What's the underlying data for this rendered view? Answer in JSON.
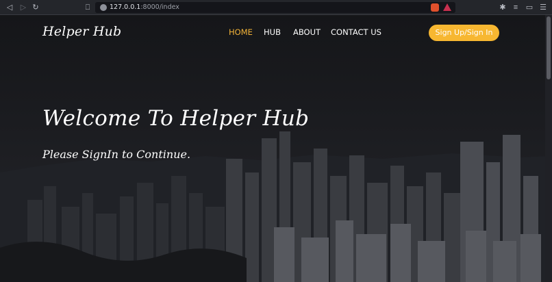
{
  "browser": {
    "url_host": "127.0.0.1",
    "url_rest": ":8000/index",
    "icons": [
      "back-icon",
      "forward-icon",
      "reload-icon",
      "bookmark-icon",
      "lock-icon",
      "brave-shields-icon",
      "brave-rewards-icon",
      "extensions-icon",
      "playlist-icon",
      "wallet-icon",
      "menu-icon"
    ]
  },
  "header": {
    "logo": "Helper Hub",
    "nav": [
      {
        "label": "HOME",
        "active": true
      },
      {
        "label": "HUB",
        "active": false
      },
      {
        "label": "ABOUT",
        "active": false
      },
      {
        "label": "CONTACT US",
        "active": false
      }
    ],
    "signin_label": "Sign Up/Sign In"
  },
  "hero": {
    "title": "Welcome To Helper Hub",
    "subtitle": "Please SignIn to Continue."
  },
  "colors": {
    "accent": "#f7b731",
    "nav_active": "#f3b338",
    "text": "#ffffff",
    "background": "#1b1c20"
  }
}
